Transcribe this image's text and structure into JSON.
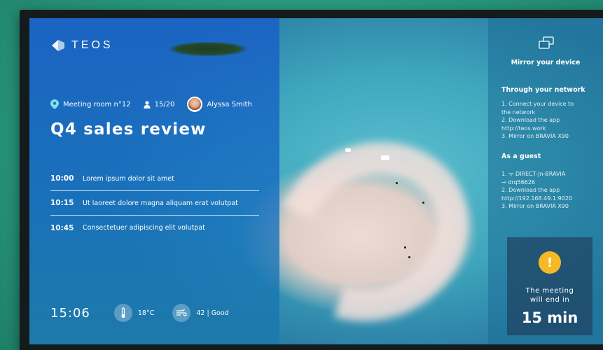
{
  "brand": {
    "name": "TEOS"
  },
  "meeting": {
    "room": "Meeting room n°12",
    "occupancy": "15/20",
    "organizer": "Alyssa Smith",
    "title": "Q4 sales review"
  },
  "agenda": [
    {
      "time": "10:00",
      "text": "Lorem ipsum dolor sit amet"
    },
    {
      "time": "10:15",
      "text": "Ut laoreet dolore magna aliquam erat volutpat"
    },
    {
      "time": "10:45",
      "text": "Consectetuer adipiscing elit volutpat"
    }
  ],
  "status": {
    "clock": "15:06",
    "temperature": "18°C",
    "air_quality": "42 | Good"
  },
  "mirror": {
    "title": "Mirror your device",
    "network_title": "Through your network",
    "network_steps": [
      "1. Connect your device to",
      "the network",
      "2. Download the app",
      "http://teos.work",
      "3. Mirror on BRAVIA X90"
    ],
    "guest_title": "As a guest",
    "guest_steps": [
      "1. ᯤ DIRECT-Jn-BRAVIA",
      "⊸ drq56626",
      "2. Download the app",
      "http://192.168.49.1:9020",
      "3. Mirror on BRAVIA X90"
    ]
  },
  "alert": {
    "icon": "!",
    "message_line1": "The meeting",
    "message_line2": "will end in",
    "remaining": "15 min",
    "color": "#f6b823"
  },
  "icons": {
    "location": "location-pin-icon",
    "occupancy": "person-icon",
    "temperature": "thermometer-icon",
    "air": "wind-icon",
    "mirror": "screen-mirror-icon",
    "alert": "warning-icon"
  }
}
